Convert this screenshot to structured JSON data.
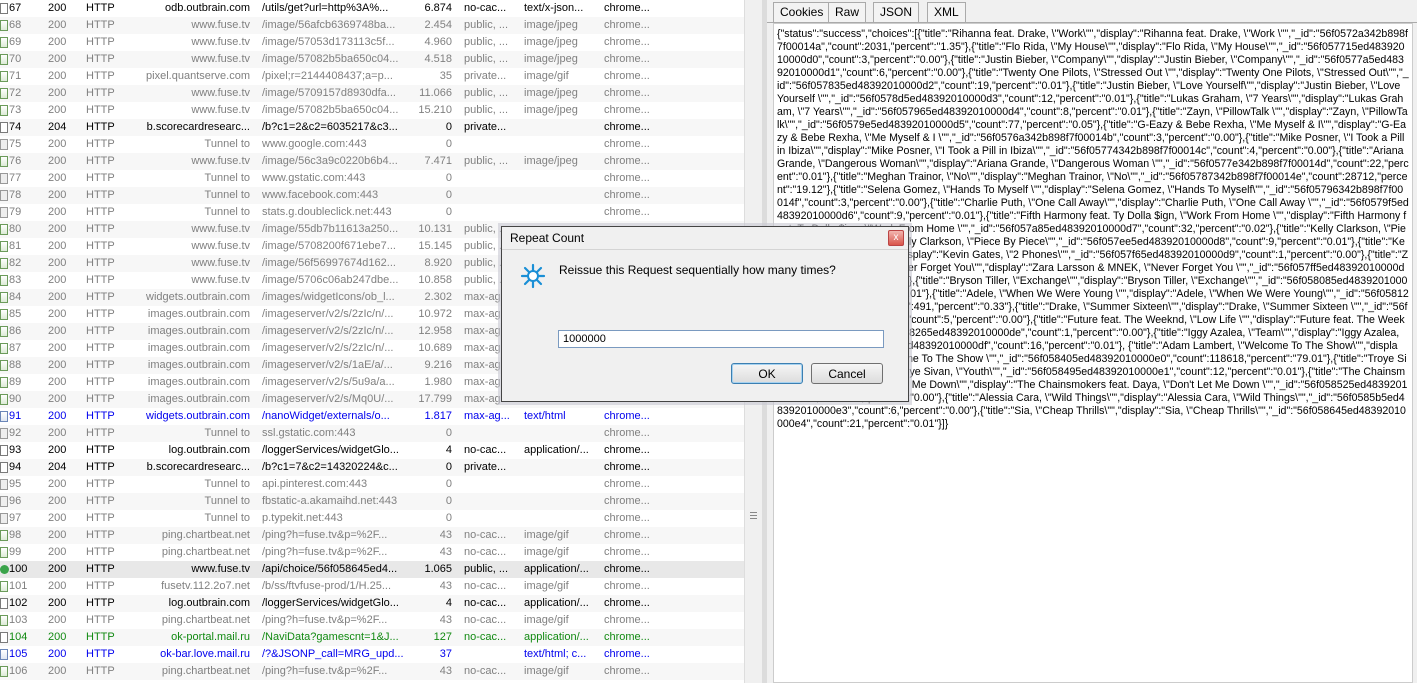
{
  "sessions": [
    {
      "num": "67",
      "result": "200",
      "protocol": "HTTP",
      "host": "odb.outbrain.com",
      "url": "/utils/get?url=http%3A%...",
      "body": "6.874",
      "caching": "no-cac...",
      "ctype": "text/x-json...",
      "process": "chrome...",
      "color": "black",
      "icon": "js"
    },
    {
      "num": "68",
      "result": "200",
      "protocol": "HTTP",
      "host": "www.fuse.tv",
      "url": "/image/56afcb6369748ba...",
      "body": "2.454",
      "caching": "public, ...",
      "ctype": "image/jpeg",
      "process": "chrome...",
      "color": "gray",
      "icon": "img"
    },
    {
      "num": "69",
      "result": "200",
      "protocol": "HTTP",
      "host": "www.fuse.tv",
      "url": "/image/57053d173113c5f...",
      "body": "4.960",
      "caching": "public, ...",
      "ctype": "image/jpeg",
      "process": "chrome...",
      "color": "gray",
      "icon": "img"
    },
    {
      "num": "70",
      "result": "200",
      "protocol": "HTTP",
      "host": "www.fuse.tv",
      "url": "/image/57082b5ba650c04...",
      "body": "4.518",
      "caching": "public, ...",
      "ctype": "image/jpeg",
      "process": "chrome...",
      "color": "gray",
      "icon": "img"
    },
    {
      "num": "71",
      "result": "200",
      "protocol": "HTTP",
      "host": "pixel.quantserve.com",
      "url": "/pixel;r=2144408437;a=p...",
      "body": "35",
      "caching": "private...",
      "ctype": "image/gif",
      "process": "chrome...",
      "color": "gray",
      "icon": "img"
    },
    {
      "num": "72",
      "result": "200",
      "protocol": "HTTP",
      "host": "www.fuse.tv",
      "url": "/image/5709157d8930dfa...",
      "body": "11.066",
      "caching": "public, ...",
      "ctype": "image/jpeg",
      "process": "chrome...",
      "color": "gray",
      "icon": "img"
    },
    {
      "num": "73",
      "result": "200",
      "protocol": "HTTP",
      "host": "www.fuse.tv",
      "url": "/image/57082b5ba650c04...",
      "body": "15.210",
      "caching": "public, ...",
      "ctype": "image/jpeg",
      "process": "chrome...",
      "color": "gray",
      "icon": "img"
    },
    {
      "num": "74",
      "result": "204",
      "protocol": "HTTP",
      "host": "b.scorecardresearc...",
      "url": "/b?c1=2&c2=6035217&c3...",
      "body": "0",
      "caching": "private...",
      "ctype": "",
      "process": "chrome...",
      "color": "black",
      "icon": "js"
    },
    {
      "num": "75",
      "result": "200",
      "protocol": "HTTP",
      "host": "Tunnel to",
      "url": "www.google.com:443",
      "body": "0",
      "caching": "",
      "ctype": "",
      "process": "chrome...",
      "color": "gray",
      "icon": "lock"
    },
    {
      "num": "76",
      "result": "200",
      "protocol": "HTTP",
      "host": "www.fuse.tv",
      "url": "/image/56c3a9c0220b6b4...",
      "body": "7.471",
      "caching": "public, ...",
      "ctype": "image/jpeg",
      "process": "chrome...",
      "color": "gray",
      "icon": "img"
    },
    {
      "num": "77",
      "result": "200",
      "protocol": "HTTP",
      "host": "Tunnel to",
      "url": "www.gstatic.com:443",
      "body": "0",
      "caching": "",
      "ctype": "",
      "process": "chrome...",
      "color": "gray",
      "icon": "lock"
    },
    {
      "num": "78",
      "result": "200",
      "protocol": "HTTP",
      "host": "Tunnel to",
      "url": "www.facebook.com:443",
      "body": "0",
      "caching": "",
      "ctype": "",
      "process": "chrome...",
      "color": "gray",
      "icon": "lock"
    },
    {
      "num": "79",
      "result": "200",
      "protocol": "HTTP",
      "host": "Tunnel to",
      "url": "stats.g.doubleclick.net:443",
      "body": "0",
      "caching": "",
      "ctype": "",
      "process": "chrome...",
      "color": "gray",
      "icon": "lock"
    },
    {
      "num": "80",
      "result": "200",
      "protocol": "HTTP",
      "host": "www.fuse.tv",
      "url": "/image/55db7b11613a250...",
      "body": "10.131",
      "caching": "public, ...",
      "ctype": "",
      "process": "",
      "color": "gray",
      "icon": "img"
    },
    {
      "num": "81",
      "result": "200",
      "protocol": "HTTP",
      "host": "www.fuse.tv",
      "url": "/image/5708200f671ebe7...",
      "body": "15.145",
      "caching": "public, ...",
      "ctype": "",
      "process": "",
      "color": "gray",
      "icon": "img"
    },
    {
      "num": "82",
      "result": "200",
      "protocol": "HTTP",
      "host": "www.fuse.tv",
      "url": "/image/56f56997674d162...",
      "body": "8.920",
      "caching": "public, ...",
      "ctype": "",
      "process": "",
      "color": "gray",
      "icon": "img"
    },
    {
      "num": "83",
      "result": "200",
      "protocol": "HTTP",
      "host": "www.fuse.tv",
      "url": "/image/5706c06ab247dbe...",
      "body": "10.858",
      "caching": "public, ...",
      "ctype": "",
      "process": "",
      "color": "gray",
      "icon": "img"
    },
    {
      "num": "84",
      "result": "200",
      "protocol": "HTTP",
      "host": "widgets.outbrain.com",
      "url": "/images/widgetIcons/ob_l...",
      "body": "2.302",
      "caching": "max-ag",
      "ctype": "",
      "process": "",
      "color": "gray",
      "icon": "img"
    },
    {
      "num": "85",
      "result": "200",
      "protocol": "HTTP",
      "host": "images.outbrain.com",
      "url": "/imageserver/v2/s/2zIc/n/...",
      "body": "10.972",
      "caching": "max-ag",
      "ctype": "",
      "process": "",
      "color": "gray",
      "icon": "img"
    },
    {
      "num": "86",
      "result": "200",
      "protocol": "HTTP",
      "host": "images.outbrain.com",
      "url": "/imageserver/v2/s/2zIc/n/...",
      "body": "12.958",
      "caching": "max-ag",
      "ctype": "",
      "process": "",
      "color": "gray",
      "icon": "img"
    },
    {
      "num": "87",
      "result": "200",
      "protocol": "HTTP",
      "host": "images.outbrain.com",
      "url": "/imageserver/v2/s/2zIc/n/...",
      "body": "10.689",
      "caching": "max-ag",
      "ctype": "",
      "process": "",
      "color": "gray",
      "icon": "img"
    },
    {
      "num": "88",
      "result": "200",
      "protocol": "HTTP",
      "host": "images.outbrain.com",
      "url": "/imageserver/v2/s/1aE/a/...",
      "body": "9.216",
      "caching": "max-ag",
      "ctype": "",
      "process": "",
      "color": "gray",
      "icon": "img"
    },
    {
      "num": "89",
      "result": "200",
      "protocol": "HTTP",
      "host": "images.outbrain.com",
      "url": "/imageserver/v2/s/5u9a/a...",
      "body": "1.980",
      "caching": "max-ag",
      "ctype": "",
      "process": "",
      "color": "gray",
      "icon": "img"
    },
    {
      "num": "90",
      "result": "200",
      "protocol": "HTTP",
      "host": "images.outbrain.com",
      "url": "/imageserver/v2/s/Mq0U/...",
      "body": "17.799",
      "caching": "max-ag",
      "ctype": "",
      "process": "",
      "color": "gray",
      "icon": "img"
    },
    {
      "num": "91",
      "result": "200",
      "protocol": "HTTP",
      "host": "widgets.outbrain.com",
      "url": "/nanoWidget/externals/o...",
      "body": "1.817",
      "caching": "max-ag...",
      "ctype": "text/html",
      "process": "chrome...",
      "color": "blue",
      "icon": "page"
    },
    {
      "num": "92",
      "result": "200",
      "protocol": "HTTP",
      "host": "Tunnel to",
      "url": "ssl.gstatic.com:443",
      "body": "0",
      "caching": "",
      "ctype": "",
      "process": "chrome...",
      "color": "gray",
      "icon": "lock"
    },
    {
      "num": "93",
      "result": "200",
      "protocol": "HTTP",
      "host": "log.outbrain.com",
      "url": "/loggerServices/widgetGlo...",
      "body": "4",
      "caching": "no-cac...",
      "ctype": "application/...",
      "process": "chrome...",
      "color": "black",
      "icon": "js"
    },
    {
      "num": "94",
      "result": "204",
      "protocol": "HTTP",
      "host": "b.scorecardresearc...",
      "url": "/b?c1=7&c2=14320224&c...",
      "body": "0",
      "caching": "private...",
      "ctype": "",
      "process": "chrome...",
      "color": "black",
      "icon": "js"
    },
    {
      "num": "95",
      "result": "200",
      "protocol": "HTTP",
      "host": "Tunnel to",
      "url": "api.pinterest.com:443",
      "body": "0",
      "caching": "",
      "ctype": "",
      "process": "chrome...",
      "color": "gray",
      "icon": "lock"
    },
    {
      "num": "96",
      "result": "200",
      "protocol": "HTTP",
      "host": "Tunnel to",
      "url": "fbstatic-a.akamaihd.net:443",
      "body": "0",
      "caching": "",
      "ctype": "",
      "process": "chrome...",
      "color": "gray",
      "icon": "lock"
    },
    {
      "num": "97",
      "result": "200",
      "protocol": "HTTP",
      "host": "Tunnel to",
      "url": "p.typekit.net:443",
      "body": "0",
      "caching": "",
      "ctype": "",
      "process": "chrome...",
      "color": "gray",
      "icon": "lock"
    },
    {
      "num": "98",
      "result": "200",
      "protocol": "HTTP",
      "host": "ping.chartbeat.net",
      "url": "/ping?h=fuse.tv&p=%2F...",
      "body": "43",
      "caching": "no-cac...",
      "ctype": "image/gif",
      "process": "chrome...",
      "color": "gray",
      "icon": "img"
    },
    {
      "num": "99",
      "result": "200",
      "protocol": "HTTP",
      "host": "ping.chartbeat.net",
      "url": "/ping?h=fuse.tv&p=%2F...",
      "body": "43",
      "caching": "no-cac...",
      "ctype": "image/gif",
      "process": "chrome...",
      "color": "gray",
      "icon": "img"
    },
    {
      "num": "100",
      "result": "200",
      "protocol": "HTTP",
      "host": "www.fuse.tv",
      "url": "/api/choice/56f058645ed4...",
      "body": "1.065",
      "caching": "public, ...",
      "ctype": "application/...",
      "process": "chrome...",
      "color": "black",
      "icon": "arrow",
      "selected": true
    },
    {
      "num": "101",
      "result": "200",
      "protocol": "HTTP",
      "host": "fusetv.112.2o7.net",
      "url": "/b/ss/ftvfuse-prod/1/H.25...",
      "body": "43",
      "caching": "no-cac...",
      "ctype": "image/gif",
      "process": "chrome...",
      "color": "gray",
      "icon": "img"
    },
    {
      "num": "102",
      "result": "200",
      "protocol": "HTTP",
      "host": "log.outbrain.com",
      "url": "/loggerServices/widgetGlo...",
      "body": "4",
      "caching": "no-cac...",
      "ctype": "application/...",
      "process": "chrome...",
      "color": "black",
      "icon": "js"
    },
    {
      "num": "103",
      "result": "200",
      "protocol": "HTTP",
      "host": "ping.chartbeat.net",
      "url": "/ping?h=fuse.tv&p=%2F...",
      "body": "43",
      "caching": "no-cac...",
      "ctype": "image/gif",
      "process": "chrome...",
      "color": "gray",
      "icon": "img"
    },
    {
      "num": "104",
      "result": "200",
      "protocol": "HTTP",
      "host": "ok-portal.mail.ru",
      "url": "/NaviData?gamescnt=1&J...",
      "body": "127",
      "caching": "no-cac...",
      "ctype": "application/...",
      "process": "chrome...",
      "color": "green",
      "icon": "js"
    },
    {
      "num": "105",
      "result": "200",
      "protocol": "HTTP",
      "host": "ok-bar.love.mail.ru",
      "url": "/?&JSONP_call=MRG_upd...",
      "body": "37",
      "caching": "",
      "ctype": "text/html; c...",
      "process": "chrome...",
      "color": "blue",
      "icon": "page"
    },
    {
      "num": "106",
      "result": "200",
      "protocol": "HTTP",
      "host": "ping.chartbeat.net",
      "url": "/ping?h=fuse.tv&p=%2F...",
      "body": "43",
      "caching": "no-cac...",
      "ctype": "image/gif",
      "process": "chrome...",
      "color": "gray",
      "icon": "img"
    }
  ],
  "inspector": {
    "tabs": [
      "Cookies",
      "Raw",
      "JSON",
      "XML"
    ],
    "body_text": "{\"status\":\"success\",\"choices\":[{\"title\":\"Rihanna feat. Drake, \\\"Work\\\"\",\"display\":\"Rihanna feat. Drake, \\\"Work \\\"\",\"_id\":\"56f0572a342b898f7f00014a\",\"count\":2031,\"percent\":\"1.35\"},{\"title\":\"Flo Rida, \\\"My House\\\"\",\"display\":\"Flo Rida, \\\"My House\\\"\",\"_id\":\"56f057715ed48392010000d0\",\"count\":3,\"percent\":\"0.00\"},{\"title\":\"Justin Bieber, \\\"Company\\\"\",\"display\":\"Justin Bieber, \\\"Company\\\"\",\"_id\":\"56f0577a5ed48392010000d1\",\"count\":6,\"percent\":\"0.00\"},{\"title\":\"Twenty One Pilots, \\\"Stressed Out \\\"\",\"display\":\"Twenty One Pilots, \\\"Stressed Out\\\"\",\"_id\":\"56f057835ed48392010000d2\",\"count\":19,\"percent\":\"0.01\"},{\"title\":\"Justin Bieber, \\\"Love Yourself\\\"\",\"display\":\"Justin Bieber, \\\"Love Yourself \\\"\",\"_id\":\"56f0578d5ed48392010000d3\",\"count\":12,\"percent\":\"0.01\"},{\"title\":\"Lukas Graham, \\\"7 Years\\\"\",\"display\":\"Lukas Graham, \\\"7 Years\\\"\",\"_id\":\"56f057965ed48392010000d4\",\"count\":8,\"percent\":\"0.01\"},{\"title\":\"Zayn, \\\"PillowTalk \\\"\",\"display\":\"Zayn, \\\"PillowTalk\\\"\",\"_id\":\"56f0579e5ed48392010000d5\",\"count\":77,\"percent\":\"0.05\"},{\"title\":\"G-Eazy & Bebe Rexha, \\\"Me Myself & I\\\"\",\"display\":\"G-Eazy & Bebe Rexha, \\\"Me Myself & I \\\"\",\"_id\":\"56f0576a342b898f7f00014b\",\"count\":3,\"percent\":\"0.00\"},{\"title\":\"Mike Posner, \\\"I Took a Pill in Ibiza\\\"\",\"display\":\"Mike Posner, \\\"I Took a Pill in Ibiza\\\"\",\"_id\":\"56f05774342b898f7f00014c\",\"count\":4,\"percent\":\"0.00\"},{\"title\":\"Ariana Grande, \\\"Dangerous Woman\\\"\",\"display\":\"Ariana Grande, \\\"Dangerous Woman \\\"\",\"_id\":\"56f0577e342b898f7f00014d\",\"count\":22,\"percent\":\"0.01\"},{\"title\":\"Meghan Trainor, \\\"No\\\"\",\"display\":\"Meghan Trainor, \\\"No\\\"\",\"_id\":\"56f05787342b898f7f00014e\",\"count\":28712,\"percent\":\"19.12\"},{\"title\":\"Selena Gomez, \\\"Hands To Myself \\\"\",\"display\":\"Selena Gomez, \\\"Hands To Myself\\\"\",\"_id\":\"56f05796342b898f7f00014f\",\"count\":3,\"percent\":\"0.00\"},{\"title\":\"Charlie Puth, \\\"One Call Away\\\"\",\"display\":\"Charlie Puth, \\\"One Call Away \\\"\",\"_id\":\"56f0579f5ed48392010000d6\",\"count\":9,\"percent\":\"0.01\"},{\"title\":\"Fifth Harmony feat. Ty Dolla $ign, \\\"Work From Home \\\"\",\"display\":\"Fifth Harmony feat. Ty Dolla $ign, \\\"Work From Home \\\"\",\"_id\":\"56f057a85ed48392010000d7\",\"count\":32,\"percent\":\"0.02\"},{\"title\":\"Kelly Clarkson, \\\"Piece By Piece\\\"\",\"display\":\"Kelly Clarkson, \\\"Piece By Piece\\\"\",\"_id\":\"56f057ee5ed48392010000d8\",\"count\":9,\"percent\":\"0.01\"},{\"title\":\"Kevin Gates, \\\"2 Phones \\\"\",\"display\":\"Kevin Gates, \\\"2 Phones\\\"\",\"_id\":\"56f057f65ed48392010000d9\",\"count\":1,\"percent\":\"0.00\"},{\"title\":\"Zara Larsson & MNEK, \\\"Never Forget You\\\"\",\"display\":\"Zara Larsson & MNEK, \\\"Never Forget You \\\"\",\"_id\":\"56f057ff5ed48392010000da\",\"count\":3,\"percent\":\"0.00\"},{\"title\":\"Bryson Tiller, \\\"Exchange\\\"\",\"display\":\"Bryson Tiller, \\\"Exchange\\\"\",\"_id\":\"56f058085ed48392010000db\",\"count\":11,\"percent\":\"0.01\"},{\"title\":\"Adele, \\\"When We Were Young \\\"\",\"display\":\"Adele, \\\"When We Were Young\\\"\",\"_id\":\"56f058125ed48392010000dc\",\"count\":491,\"percent\":\"0.33\"},{\"title\":\"Drake, \\\"Summer Sixteen\\\"\",\"display\":\"Drake, \\\"Summer Sixteen \\\"\",\"_id\":\"56f0581b5ed48392010000dd\",\"count\":5,\"percent\":\"0.00\"},{\"title\":\"Future feat. The Weeknd, \\\"Low Life \\\"\",\"display\":\"Future feat. The Weeknd, \\\"Low Life\\\"\",\"_id\":\"56f058265ed48392010000de\",\"count\":1,\"percent\":\"0.00\"},{\"title\":\"Iggy Azalea, \\\"Team\\\"\",\"display\":\"Iggy Azalea, \\\"Team\\\"\",\"_id\":\"56f058375ed48392010000df\",\"count\":16,\"percent\":\"0.01\"}, {\"title\":\"Adam Lambert, \\\"Welcome To The Show\\\"\",\"display\":\"Adam Lambert, \\\"Welcome To The Show \\\"\",\"_id\":\"56f058405ed48392010000e0\",\"count\":118618,\"percent\":\"79.01\"},{\"title\":\"Troye Sivan, \\\"Youth\\\"\",\"display\":\"Troye Sivan, \\\"Youth\\\"\",\"_id\":\"56f058495ed48392010000e1\",\"count\":12,\"percent\":\"0.01\"},{\"title\":\"The Chainsmokers feat. Daya, \\\"Don't Let Me Down\\\"\",\"display\":\"The Chainsmokers feat. Daya, \\\"Don't Let Me Down \\\"\",\"_id\":\"56f058525ed48392010000e2\",\"count\":4,\"percent\":\"0.00\"},{\"title\":\"Alessia Cara, \\\"Wild Things\\\"\",\"display\":\"Alessia Cara, \\\"Wild Things\\\"\",\"_id\":\"56f0585b5ed48392010000e3\",\"count\":6,\"percent\":\"0.00\"},{\"title\":\"Sia, \\\"Cheap Thrills\\\"\",\"display\":\"Sia, \\\"Cheap Thrills\\\"\",\"_id\":\"56f058645ed48392010000e4\",\"count\":21,\"percent\":\"0.01\"}]}"
  },
  "dialog": {
    "title": "Repeat Count",
    "close_glyph": "x",
    "prompt": "Reissue this Request sequentially how many times?",
    "value": "1000000",
    "ok_label": "OK",
    "cancel_label": "Cancel"
  },
  "colors": {
    "text_gray": "#808080",
    "text_blue": "#0000ee",
    "text_green": "#128a12",
    "dialog_icon": "#1a8fd6"
  }
}
